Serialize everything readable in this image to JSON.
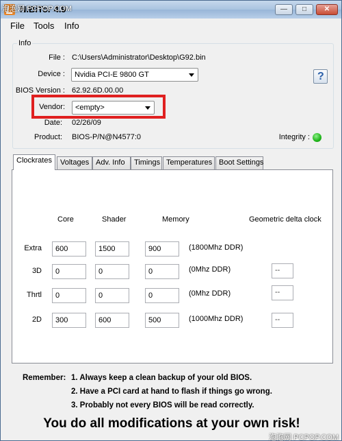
{
  "window": {
    "title": "NiBiTor 4.9",
    "watermark_top": "泡泡网 PCPOP.COM",
    "watermark_bottom": "泡泡网 PCPOP.COM",
    "controls": {
      "minimize": "—",
      "maximize": "□",
      "close": "✕"
    }
  },
  "menu": {
    "file": "File",
    "tools": "Tools",
    "info": "Info"
  },
  "info": {
    "group_title": "Info",
    "file_label": "File :",
    "file_value": "C:\\Users\\Administrator\\Desktop\\G92.bin",
    "device_label": "Device :",
    "device_value": "Nvidia PCI-E 9800 GT",
    "bios_label": "BIOS Version :",
    "bios_value": "62.92.6D.00.00",
    "vendor_label": "Vendor:",
    "vendor_value": "<empty>",
    "date_label": "Date:",
    "date_value": "02/26/09",
    "product_label": "Product:",
    "product_value": "BIOS-P/N@N4577:0",
    "integrity_label": "Integrity :",
    "help_label": "?"
  },
  "tabs": [
    "Clockrates",
    "Voltages",
    "Adv. Info",
    "Timings",
    "Temperatures",
    "Boot Settings"
  ],
  "clockrates": {
    "headers": {
      "core": "Core",
      "shader": "Shader",
      "memory": "Memory",
      "geometric": "Geometric delta clock"
    },
    "rows": [
      {
        "label": "Extra",
        "core": "600",
        "shader": "1500",
        "memory": "900",
        "ddr": "(1800Mhz DDR)",
        "delta": ""
      },
      {
        "label": "3D",
        "core": "0",
        "shader": "0",
        "memory": "0",
        "ddr": "(0Mhz DDR)",
        "delta": "--"
      },
      {
        "label": "Thrtl",
        "core": "0",
        "shader": "0",
        "memory": "0",
        "ddr": "(0Mhz DDR)",
        "delta": "--"
      },
      {
        "label": "2D",
        "core": "300",
        "shader": "600",
        "memory": "500",
        "ddr": "(1000Mhz DDR)",
        "delta": "--"
      }
    ]
  },
  "notes": {
    "remember": "Remember:",
    "line1": "1. Always keep a clean backup of your old BIOS.",
    "line2": "2. Have a PCI card at hand to flash if things go wrong.",
    "line3": "3. Probably not every BIOS will be read correctly.",
    "warning": "You do all modifications at your own risk!"
  }
}
